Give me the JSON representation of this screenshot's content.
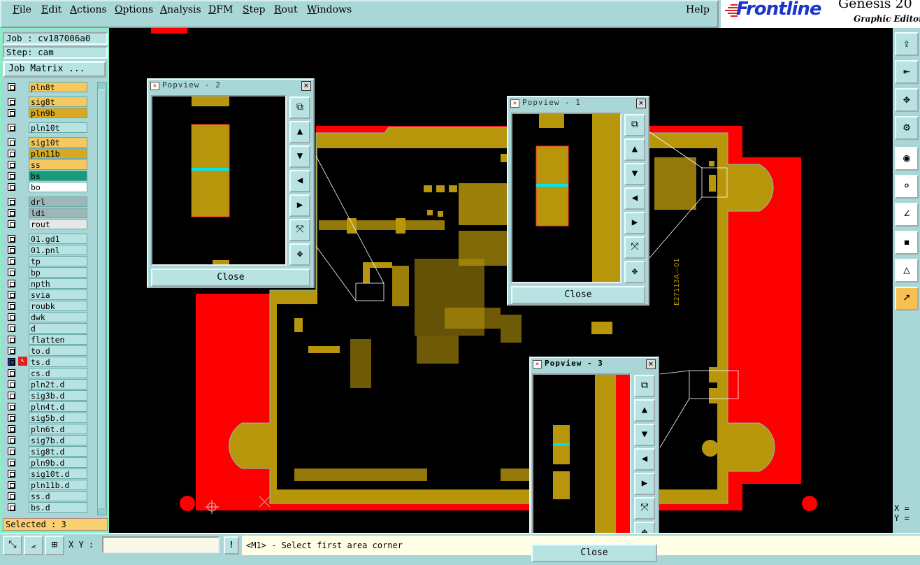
{
  "menu": {
    "items": [
      "File",
      "Edit",
      "Actions",
      "Options",
      "Analysis",
      "DFM",
      "Step",
      "Rout",
      "Windows"
    ],
    "help": "Help"
  },
  "brand": {
    "logo": "Frontline",
    "product": "Genesis 20",
    "subtitle": "Graphic Editor"
  },
  "job": {
    "job_label": "Job : cv187006a0",
    "step_label": "Step: cam",
    "matrix_button": "Job Matrix ..."
  },
  "layers": [
    {
      "name": "pln8t",
      "color": "#f6c860"
    },
    {
      "name": "sig8t",
      "color": "#f6c860"
    },
    {
      "name": "pln9b",
      "color": "#d8a820"
    },
    {
      "name": "pln10t",
      "color": "#b7e3e3"
    },
    {
      "name": "sig10t",
      "color": "#f6c860"
    },
    {
      "name": "pln11b",
      "color": "#d8a820"
    },
    {
      "name": "ss",
      "color": "#f6c860"
    },
    {
      "name": "bs",
      "color": "#1a9a78"
    },
    {
      "name": "bo",
      "color": "#ffffff"
    },
    {
      "name": "drl",
      "color": "#9fb6b8"
    },
    {
      "name": "ldi",
      "color": "#9fb6b8"
    },
    {
      "name": "rout",
      "color": "#e4e8e8"
    },
    {
      "name": "01.gd1",
      "color": "#b7e3e3"
    },
    {
      "name": "01.pnl",
      "color": "#b7e3e3"
    },
    {
      "name": "tp",
      "color": "#b7e3e3"
    },
    {
      "name": "bp",
      "color": "#b7e3e3"
    },
    {
      "name": "npth",
      "color": "#b7e3e3"
    },
    {
      "name": "svia",
      "color": "#b7e3e3"
    },
    {
      "name": "roubk",
      "color": "#b7e3e3"
    },
    {
      "name": "dwk",
      "color": "#b7e3e3"
    },
    {
      "name": "d",
      "color": "#b7e3e3"
    },
    {
      "name": "flatten",
      "color": "#b7e3e3"
    },
    {
      "name": "to.d",
      "color": "#b7e3e3"
    },
    {
      "name": "ts.d",
      "color": "#b7e3e3"
    },
    {
      "name": "cs.d",
      "color": "#b7e3e3"
    },
    {
      "name": "pln2t.d",
      "color": "#b7e3e3"
    },
    {
      "name": "sig3b.d",
      "color": "#b7e3e3"
    },
    {
      "name": "pln4t.d",
      "color": "#b7e3e3"
    },
    {
      "name": "sig5b.d",
      "color": "#b7e3e3"
    },
    {
      "name": "pln6t.d",
      "color": "#b7e3e3"
    },
    {
      "name": "sig7b.d",
      "color": "#b7e3e3"
    },
    {
      "name": "sig8t.d",
      "color": "#b7e3e3"
    },
    {
      "name": "pln9b.d",
      "color": "#b7e3e3"
    },
    {
      "name": "sig10t.d",
      "color": "#b7e3e3"
    },
    {
      "name": "pln11b.d",
      "color": "#b7e3e3"
    },
    {
      "name": "ss.d",
      "color": "#b7e3e3"
    },
    {
      "name": "bs.d",
      "color": "#b7e3e3"
    }
  ],
  "active_layer": "ts.d",
  "selected_label": "Selected : 3",
  "board_text": "E27113A—01",
  "popviews": [
    {
      "title": "Popview - 2",
      "close": "Close"
    },
    {
      "title": "Popview - 1",
      "close": "Close"
    },
    {
      "title": "Popview - 3",
      "close": "Close"
    }
  ],
  "bottom": {
    "xy_label": "X Y :",
    "xy_value": "",
    "bang": "!",
    "message": "<M1> - Select first area corner"
  },
  "coords": {
    "x": "X =",
    "y": "Y ="
  },
  "colors": {
    "ui": "#a9d6d6",
    "board_red": "#ff0000",
    "copper": "#b8960c",
    "highlight": "#00e5ee"
  }
}
